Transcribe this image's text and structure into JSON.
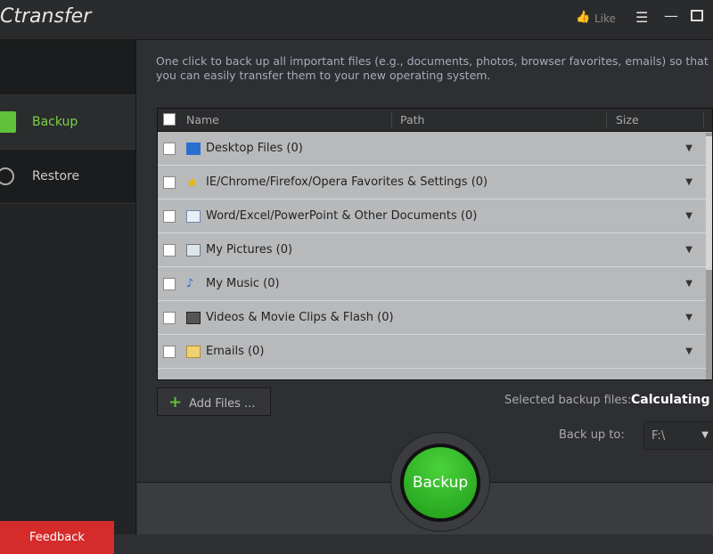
{
  "app": {
    "title": "Ctransfer",
    "like": "Like"
  },
  "sidebar": {
    "items": [
      {
        "label": "Backup",
        "active": true
      },
      {
        "label": "Restore",
        "active": false
      }
    ],
    "feedback": "Feedback"
  },
  "main": {
    "description": "One click to back up all important files (e.g., documents, photos, browser favorites, emails) so that you can easily transfer them to your new operating system.",
    "columns": [
      "Name",
      "Path",
      "Size"
    ],
    "rows": [
      {
        "label": "Desktop Files (0)",
        "icon": "monitor-icon"
      },
      {
        "label": "IE/Chrome/Firefox/Opera Favorites & Settings (0)",
        "icon": "star-icon"
      },
      {
        "label": "Word/Excel/PowerPoint & Other Documents (0)",
        "icon": "document-icon"
      },
      {
        "label": "My Pictures (0)",
        "icon": "picture-icon"
      },
      {
        "label": "My Music (0)",
        "icon": "music-icon"
      },
      {
        "label": "Videos & Movie Clips & Flash (0)",
        "icon": "film-icon"
      },
      {
        "label": "Emails (0)",
        "icon": "envelope-icon"
      }
    ],
    "add_files": "Add Files ...",
    "selected_label": "Selected backup files:",
    "selected_value": "Calculating ...",
    "backup_to_label": "Back up to:",
    "backup_to_value": "F:\\",
    "backup_button": "Backup"
  },
  "colors": {
    "accent": "#7bd34a",
    "feedback": "#d52b2b",
    "backup": "#2fb52a"
  }
}
